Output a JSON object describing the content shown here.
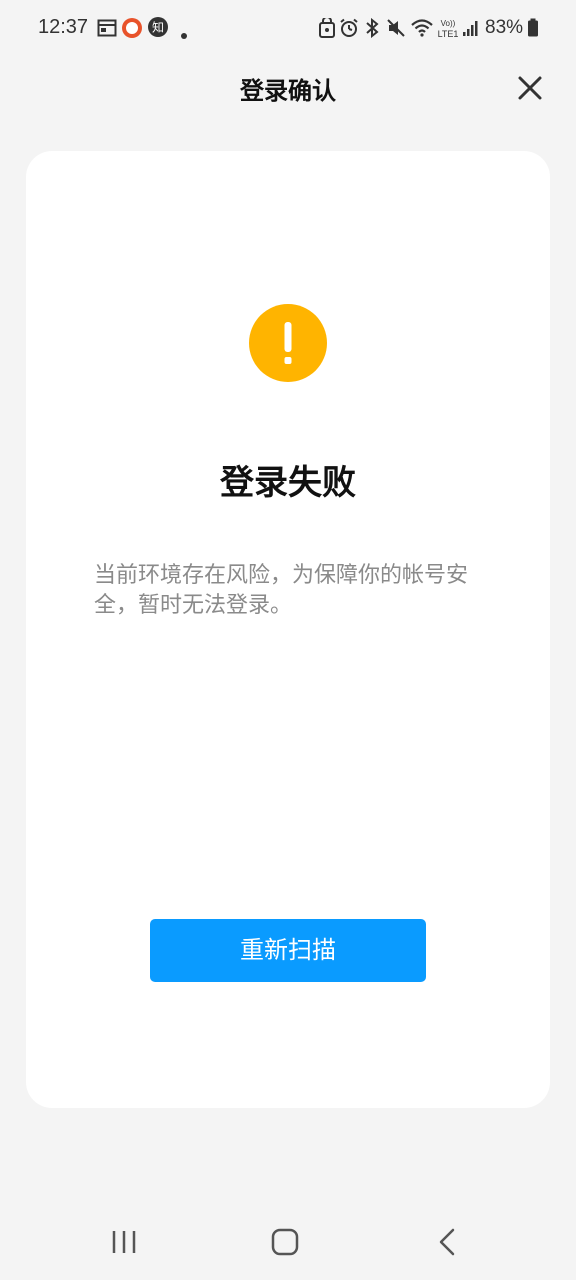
{
  "status_bar": {
    "time": "12:37",
    "battery_percent": "83%",
    "icons": [
      "calendar-icon",
      "ring-app-icon",
      "zhihu-icon",
      "dot-icon",
      "photo-lock-icon",
      "alarm-icon",
      "bluetooth-icon",
      "mute-icon",
      "wifi-icon",
      "volte-icon",
      "signal-icon",
      "battery-icon"
    ],
    "volte_label_top": "Vo))",
    "volte_label_bottom": "LTE1",
    "zhihu_glyph": "知"
  },
  "header": {
    "title": "登录确认",
    "close_icon": "close-icon"
  },
  "result": {
    "icon": "warning-icon",
    "icon_color": "#FFB400",
    "title": "登录失败",
    "message": "当前环境存在风险，为保障你的帐号安全，暂时无法登录。"
  },
  "actions": {
    "rescan_label": "重新扫描",
    "rescan_color": "#0A9BFF"
  },
  "nav_bar": {
    "items": [
      "recent-apps-icon",
      "home-icon",
      "back-icon"
    ]
  }
}
